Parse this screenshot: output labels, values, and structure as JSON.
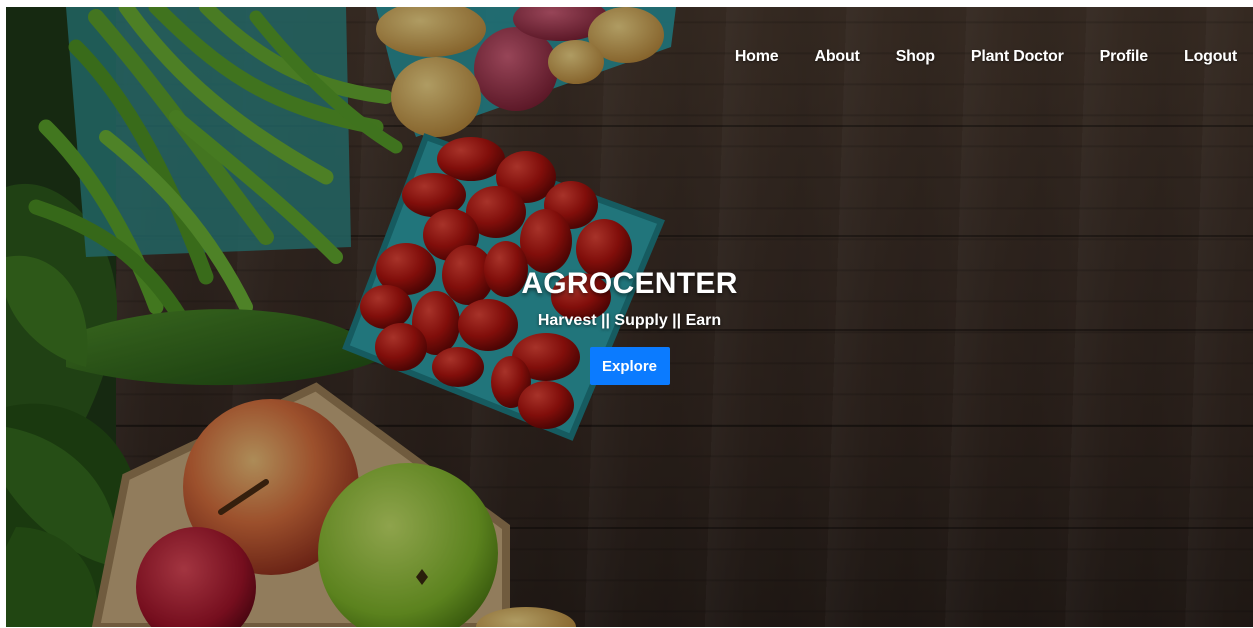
{
  "colors": {
    "accent": "#0b7bff",
    "nav_text": "#ffffff",
    "wood": "#3f3129"
  },
  "nav": {
    "items": [
      {
        "label": "Home"
      },
      {
        "label": "About"
      },
      {
        "label": "Shop"
      },
      {
        "label": "Plant Doctor"
      },
      {
        "label": "Profile"
      },
      {
        "label": "Logout"
      }
    ]
  },
  "hero": {
    "title": "AGROCENTER",
    "tagline": "Harvest || Supply || Earn",
    "cta_label": "Explore"
  }
}
